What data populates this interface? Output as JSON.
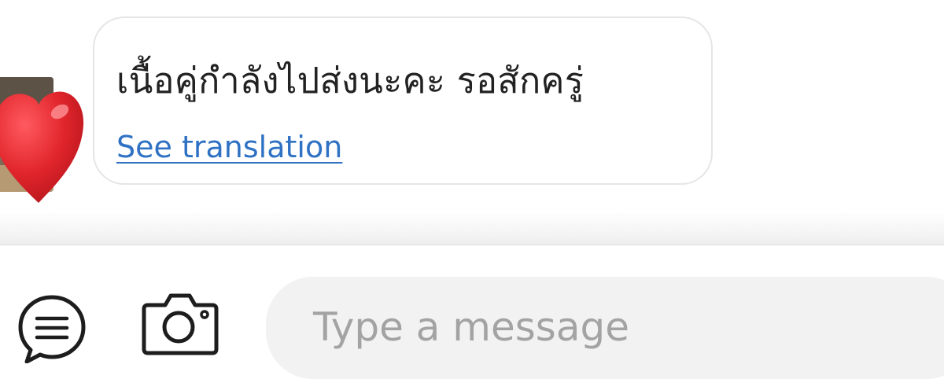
{
  "message": {
    "text": "เนื้อคู่กำลังไปส่งนะคะ รอสักครู่",
    "translate_link": "See translation"
  },
  "avatar": {
    "icon": "heart-emoji-icon",
    "heart_color": "#e1252c"
  },
  "composer": {
    "placeholder": "Type a message",
    "left_icons": [
      "chat-bubble-icon",
      "camera-icon"
    ]
  },
  "colors": {
    "link": "#2f72c4",
    "bubble_border": "#e5e5e5",
    "input_background": "#f2f2f2"
  }
}
